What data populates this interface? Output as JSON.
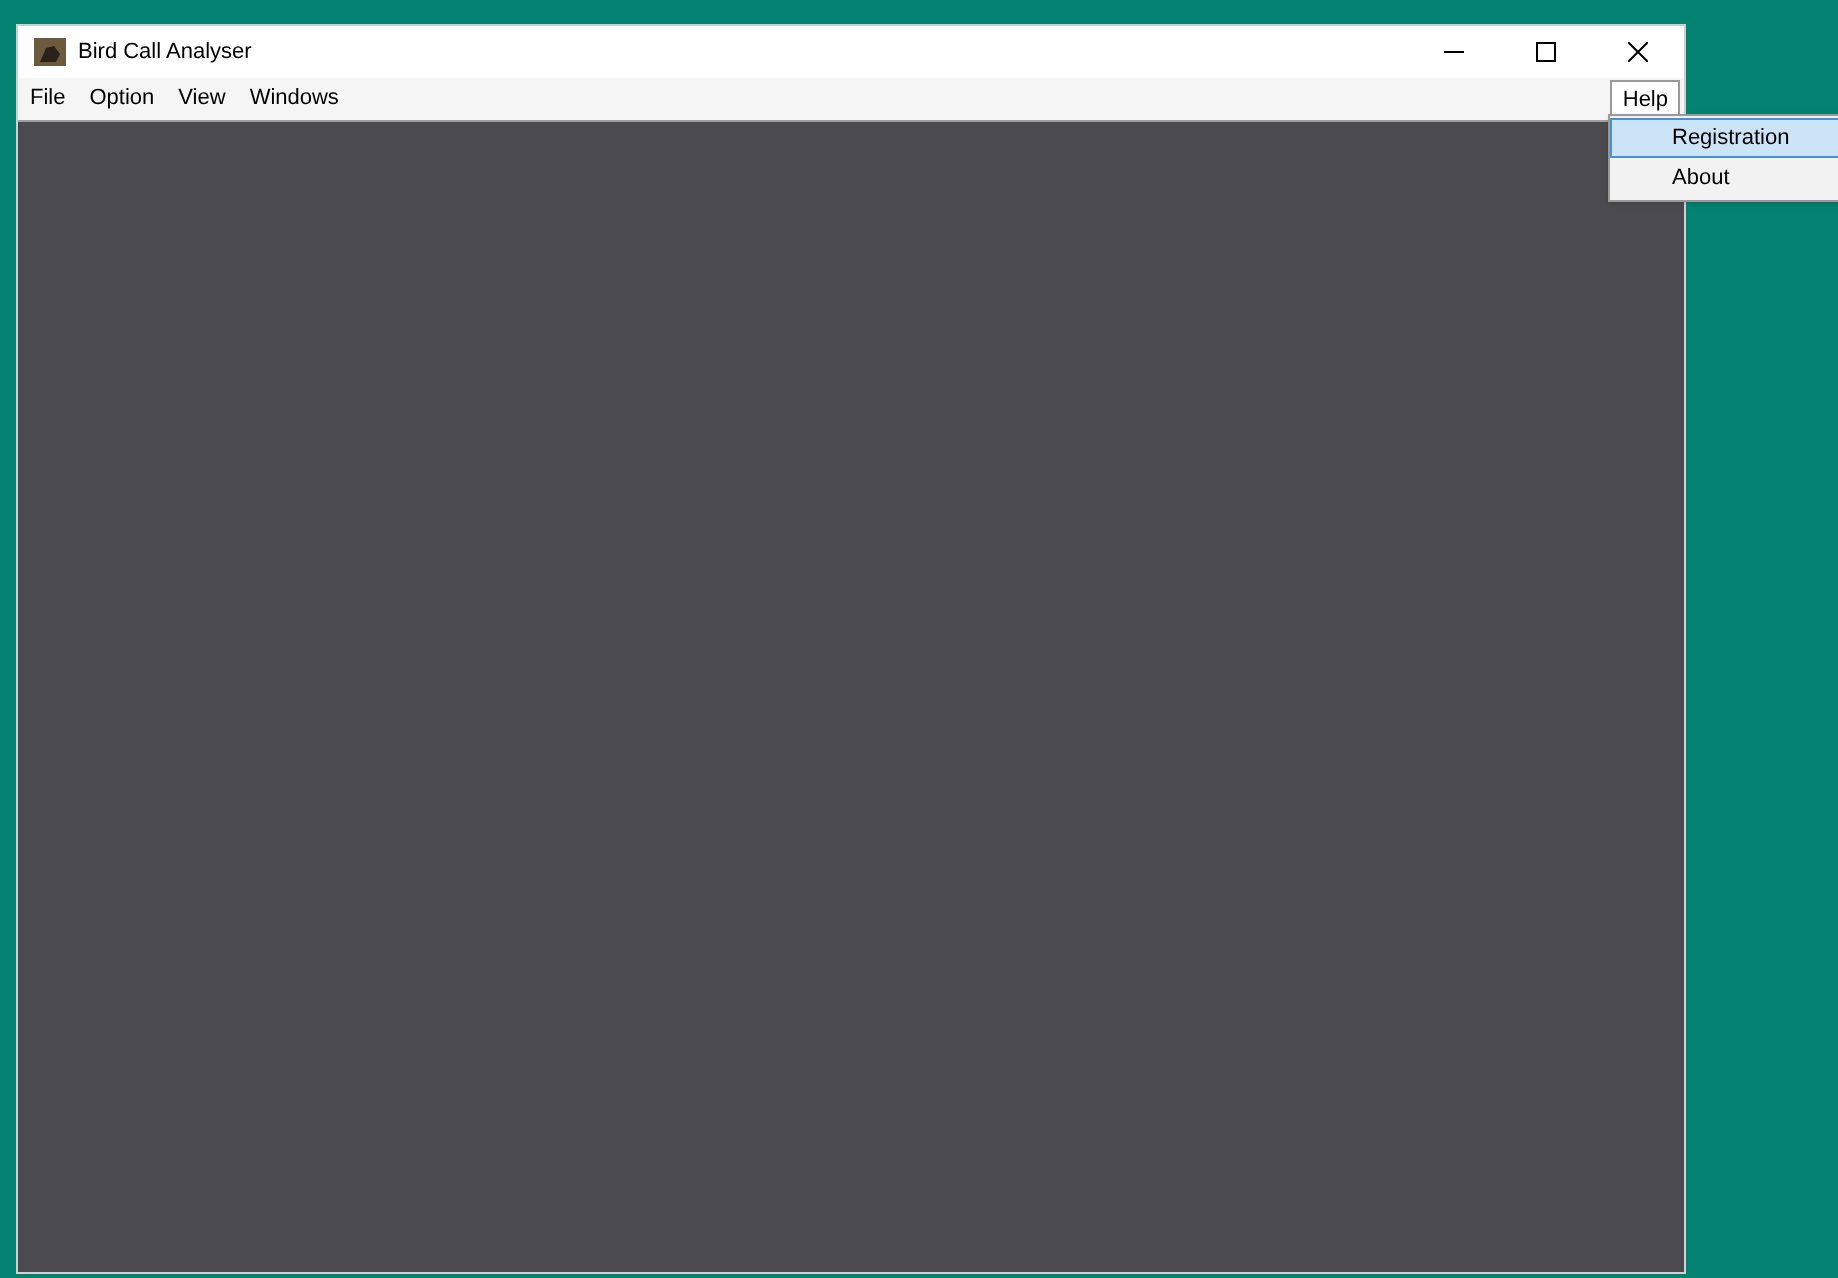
{
  "window": {
    "title": "Bird Call Analyser"
  },
  "menu_bar": [
    {
      "label": "File",
      "selected": false
    },
    {
      "label": "Option",
      "selected": false
    },
    {
      "label": "View",
      "selected": false
    },
    {
      "label": "Windows",
      "selected": false
    },
    {
      "label": "Help",
      "selected": true
    }
  ],
  "dropdown": [
    {
      "label": "Registration",
      "selected": true
    },
    {
      "label": "About",
      "selected": false
    }
  ]
}
